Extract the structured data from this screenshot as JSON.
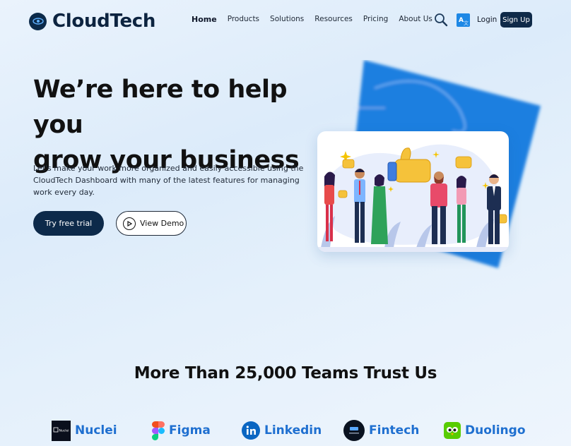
{
  "brand": {
    "name": "CloudTech",
    "logo_icon": "eye-logo-icon"
  },
  "nav": {
    "items": [
      {
        "label": "Home",
        "active": true
      },
      {
        "label": "Products"
      },
      {
        "label": "Solutions"
      },
      {
        "label": "Resources"
      },
      {
        "label": "Pricing"
      },
      {
        "label": "About Us"
      }
    ],
    "search_icon": "search-icon",
    "language_icon": "translate-icon",
    "login_label": "Login",
    "signup_label": "Sign Up"
  },
  "hero": {
    "title_line1": "We’re here to help you",
    "title_line2": "grow your business",
    "description": "Let's make your work more organized and easily accessible using the CloudTech Dashboard with many of the latest features for managing work every day.",
    "primary_button": "Try free trial",
    "secondary_button": "View Demo",
    "illustration": "team-thumbs-up-illustration"
  },
  "trust": {
    "title": "More Than 25,000 Teams Trust Us",
    "logos": [
      {
        "name": "Nuclei",
        "badge_text": "Nuclei",
        "icon": "nuclei-logo-icon"
      },
      {
        "name": "Figma",
        "icon": "figma-logo-icon"
      },
      {
        "name": "Linkedin",
        "icon": "linkedin-logo-icon"
      },
      {
        "name": "Fintech",
        "icon": "fintech-logo-icon"
      },
      {
        "name": "Duolingo",
        "icon": "duolingo-logo-icon"
      }
    ]
  },
  "colors": {
    "primary": "#0d2a4a",
    "accent_blue": "#1e88e5",
    "logo_text": "#1e6fd0"
  }
}
